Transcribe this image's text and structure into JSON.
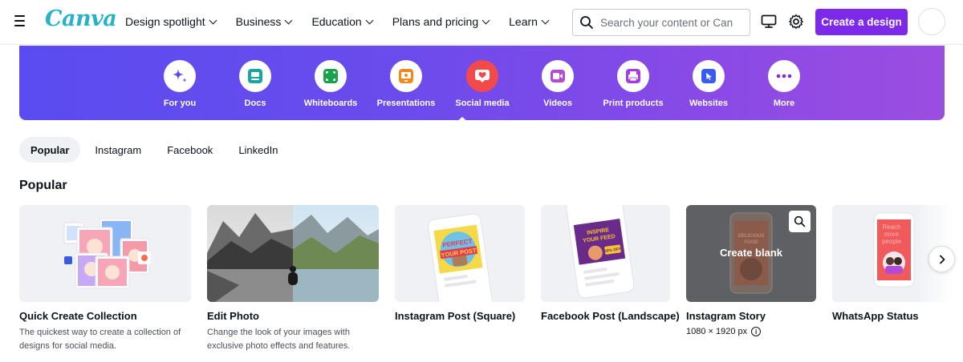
{
  "brand": {
    "logo_text": "Canva",
    "accent": "#7d2ae8",
    "logo_color": "#27b3c6"
  },
  "nav": {
    "items": [
      {
        "label": "Design spotlight"
      },
      {
        "label": "Business"
      },
      {
        "label": "Education"
      },
      {
        "label": "Plans and pricing"
      },
      {
        "label": "Learn"
      }
    ],
    "search_placeholder": "Search your content or Can",
    "create_label": "Create a design",
    "icons": [
      "menu-icon",
      "search-icon",
      "desktop-icon",
      "gear-icon"
    ]
  },
  "categories": [
    {
      "label": "For you",
      "icon": "sparkle-icon",
      "color": "#5a4cf0"
    },
    {
      "label": "Docs",
      "icon": "doc-icon",
      "color": "#19a5a0"
    },
    {
      "label": "Whiteboards",
      "icon": "whiteboard-icon",
      "color": "#1aa34a"
    },
    {
      "label": "Presentations",
      "icon": "presentation-icon",
      "color": "#f08a1c"
    },
    {
      "label": "Social media",
      "icon": "heart-icon",
      "color": "#f24a4a",
      "active": true
    },
    {
      "label": "Videos",
      "icon": "video-icon",
      "color": "#b54ad9"
    },
    {
      "label": "Print products",
      "icon": "printer-icon",
      "color": "#a83cdf"
    },
    {
      "label": "Websites",
      "icon": "cursor-icon",
      "color": "#3a5bf0"
    },
    {
      "label": "More",
      "icon": "more-icon",
      "color": "#7d2ae8"
    }
  ],
  "filters": [
    {
      "label": "Popular",
      "active": true
    },
    {
      "label": "Instagram"
    },
    {
      "label": "Facebook"
    },
    {
      "label": "LinkedIn"
    }
  ],
  "popular": {
    "title": "Popular",
    "cards": [
      {
        "title": "Quick Create Collection",
        "desc": "The quickest way to create a collection of designs for social media."
      },
      {
        "title": "Edit Photo",
        "desc": "Change the look of your images with exclusive photo effects and features."
      },
      {
        "title": "Instagram Post (Square)",
        "thumb_text": [
          "PERFECT",
          "YOUR POST"
        ]
      },
      {
        "title": "Facebook Post (Landscape)",
        "thumb_text": [
          "INSPIRE",
          "YOUR FEED",
          "50% OFF"
        ]
      },
      {
        "title": "Instagram Story",
        "meta": "1080 × 1920 px",
        "hover_label": "Create blank",
        "thumb_text": [
          "DELICIOUS",
          "FOOD"
        ]
      },
      {
        "title": "WhatsApp Status",
        "thumb_text": [
          "Reach",
          "more",
          "people"
        ]
      }
    ]
  }
}
